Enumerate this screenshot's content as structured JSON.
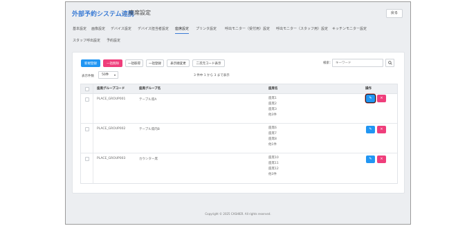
{
  "header": {
    "app_title": "外部予約システム連携",
    "separator": "＞",
    "page_title": "座席設定",
    "back_label": "戻る"
  },
  "tabs": [
    {
      "label": "基本設定"
    },
    {
      "label": "画像設定"
    },
    {
      "label": "デバイス設定"
    },
    {
      "label": "デバイス担当者設定"
    },
    {
      "label": "座席設定"
    },
    {
      "label": "プリンタ設定"
    },
    {
      "label": "呼出モニター（受付用）設定"
    },
    {
      "label": "呼出モニター（スタッフ用）設定"
    },
    {
      "label": "キッチンモニター設定"
    },
    {
      "label": "スタッフ呼出設定"
    },
    {
      "label": "予約設定"
    }
  ],
  "toolbar": {
    "new_label": "新規登録",
    "bulk_delete_label": "一括削除",
    "bulk_get_label": "一括取得",
    "bulk_register_label": "一括登録",
    "display_order_label": "表示順変更",
    "qr_label": "二次元コード表示",
    "search_label": "検索：",
    "search_placeholder": "キーワード"
  },
  "pagination": {
    "per_page_label": "表示件数",
    "per_page_value": "50件",
    "count_text": "3 件中 1 から 3 まで表示"
  },
  "table": {
    "headers": {
      "group_code": "座席グループコード",
      "group_name": "座席グループ名",
      "seat_name": "座席名",
      "actions": "操作"
    },
    "rows": [
      {
        "code": "PLACE_GROUP001",
        "name": "テーブル席A",
        "seats": [
          "座席1",
          "座席2",
          "座席3",
          "他3件"
        ]
      },
      {
        "code": "PLACE_GROUP002",
        "name": "テーブル席内B",
        "seats": [
          "座席6",
          "座席7",
          "座席8",
          "他1件"
        ]
      },
      {
        "code": "PLACE_GROUP003",
        "name": "カウンター席",
        "seats": [
          "座席10",
          "座席11",
          "座席12",
          "他3件"
        ]
      }
    ]
  },
  "footer": {
    "copyright": "Copyright © 2025 CASHIER. All rights reserved."
  },
  "icons": {
    "edit": "edit-icon",
    "delete": "close-icon",
    "search": "search-icon"
  },
  "colors": {
    "accent": "#3a7bd5",
    "primary_button": "#2196f3",
    "danger_button": "#ef3e7b"
  }
}
